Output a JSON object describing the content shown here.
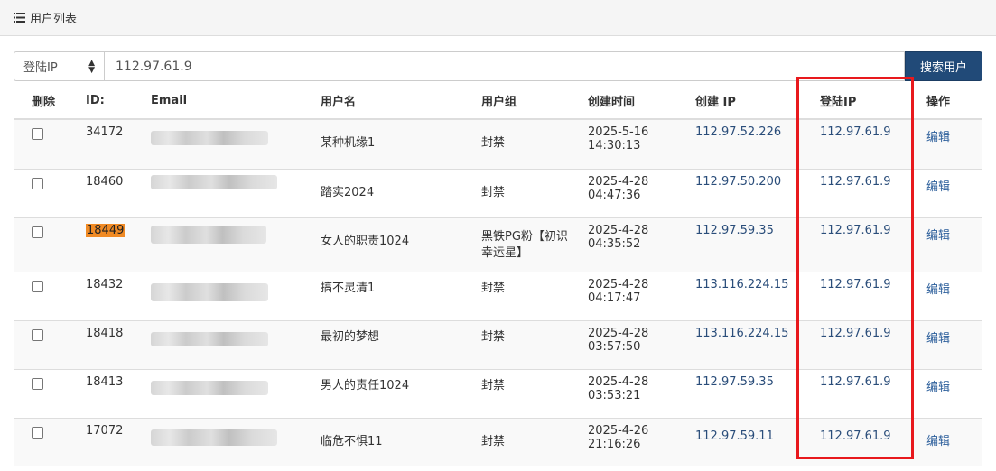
{
  "panel": {
    "title": "用户列表",
    "icon": "list-icon"
  },
  "search": {
    "field": "登陆IP",
    "value": "112.97.61.9",
    "button": "搜索用户"
  },
  "columns": {
    "delete": "删除",
    "id": "ID:",
    "email": "Email",
    "username": "用户名",
    "group": "用户组",
    "created": "创建时间",
    "create_ip": "创建 IP",
    "login_ip": "登陆IP",
    "action": "操作"
  },
  "rows": [
    {
      "id": "34172",
      "username": "某种机缘1",
      "group": "封禁",
      "created_date": "2025-5-16",
      "created_time": "14:30:13",
      "create_ip": "112.97.52.226",
      "login_ip": "112.97.61.9",
      "action": "编辑"
    },
    {
      "id": "18460",
      "username": "踏实2024",
      "group": "封禁",
      "created_date": "2025-4-28",
      "created_time": "04:47:36",
      "create_ip": "112.97.50.200",
      "login_ip": "112.97.61.9",
      "action": "编辑"
    },
    {
      "id": "18449",
      "username": "女人的职责1024",
      "group": "黑铁PG粉【初识幸运星】",
      "created_date": "2025-4-28",
      "created_time": "04:35:52",
      "create_ip": "112.97.59.35",
      "login_ip": "112.97.61.9",
      "action": "编辑"
    },
    {
      "id": "18432",
      "username": "搞不灵清1",
      "group": "封禁",
      "created_date": "2025-4-28",
      "created_time": "04:17:47",
      "create_ip": "113.116.224.15",
      "login_ip": "112.97.61.9",
      "action": "编辑"
    },
    {
      "id": "18418",
      "username": "最初的梦想",
      "group": "封禁",
      "created_date": "2025-4-28",
      "created_time": "03:57:50",
      "create_ip": "113.116.224.15",
      "login_ip": "112.97.61.9",
      "action": "编辑"
    },
    {
      "id": "18413",
      "username": "男人的责任1024",
      "group": "封禁",
      "created_date": "2025-4-28",
      "created_time": "03:53:21",
      "create_ip": "112.97.59.35",
      "login_ip": "112.97.61.9",
      "action": "编辑"
    },
    {
      "id": "17072",
      "username": "临危不惧11",
      "group": "封禁",
      "created_date": "2025-4-26",
      "created_time": "21:16:26",
      "create_ip": "112.97.59.11",
      "login_ip": "112.97.61.9",
      "action": "编辑"
    }
  ],
  "highlight": {
    "id_highlight_color": "#f08a24",
    "box_color": "#e8191d",
    "button_color": "#214a78"
  }
}
